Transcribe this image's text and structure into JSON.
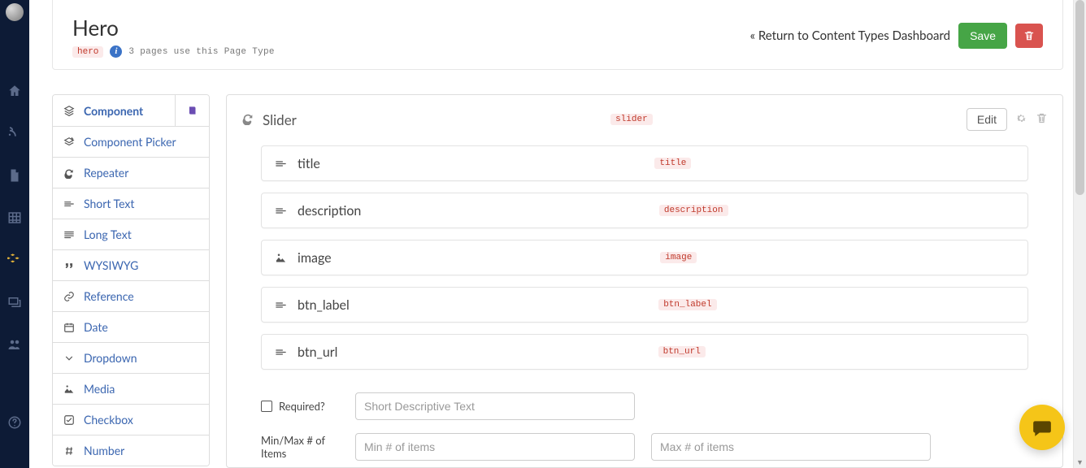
{
  "header": {
    "title": "Hero",
    "slug": "hero",
    "usage_text": "3 pages use this Page Type",
    "dashboard_link": "« Return to Content Types Dashboard",
    "save_label": "Save"
  },
  "sidenav": {
    "items": [
      {
        "name": "home-icon"
      },
      {
        "name": "blog-icon"
      },
      {
        "name": "page-icon"
      },
      {
        "name": "table-icon"
      },
      {
        "name": "components-icon",
        "active": true
      },
      {
        "name": "gallery-icon"
      },
      {
        "name": "users-icon"
      }
    ]
  },
  "field_types": [
    {
      "label": "Component",
      "icon": "layers",
      "active": true,
      "side": true
    },
    {
      "label": "Component Picker",
      "icon": "layers-plus"
    },
    {
      "label": "Repeater",
      "icon": "refresh"
    },
    {
      "label": "Short Text",
      "icon": "short-text"
    },
    {
      "label": "Long Text",
      "icon": "long-text"
    },
    {
      "label": "WYSIWYG",
      "icon": "quote"
    },
    {
      "label": "Reference",
      "icon": "link"
    },
    {
      "label": "Date",
      "icon": "calendar"
    },
    {
      "label": "Dropdown",
      "icon": "chevron-down"
    },
    {
      "label": "Media",
      "icon": "image"
    },
    {
      "label": "Checkbox",
      "icon": "check-square"
    },
    {
      "label": "Number",
      "icon": "hash"
    }
  ],
  "editor": {
    "title": "Slider",
    "slug": "slider",
    "edit_label": "Edit",
    "fields": [
      {
        "name": "title",
        "slug": "title",
        "icon": "short-text"
      },
      {
        "name": "description",
        "slug": "description",
        "icon": "short-text"
      },
      {
        "name": "image",
        "slug": "image",
        "icon": "image"
      },
      {
        "name": "btn_label",
        "slug": "btn_label",
        "icon": "short-text"
      },
      {
        "name": "btn_url",
        "slug": "btn_url",
        "icon": "short-text"
      }
    ],
    "config": {
      "required_label": "Required?",
      "required_placeholder": "Short Descriptive Text",
      "minmax_label": "Min/Max # of Items",
      "min_placeholder": "Min # of items",
      "max_placeholder": "Max # of items"
    }
  }
}
